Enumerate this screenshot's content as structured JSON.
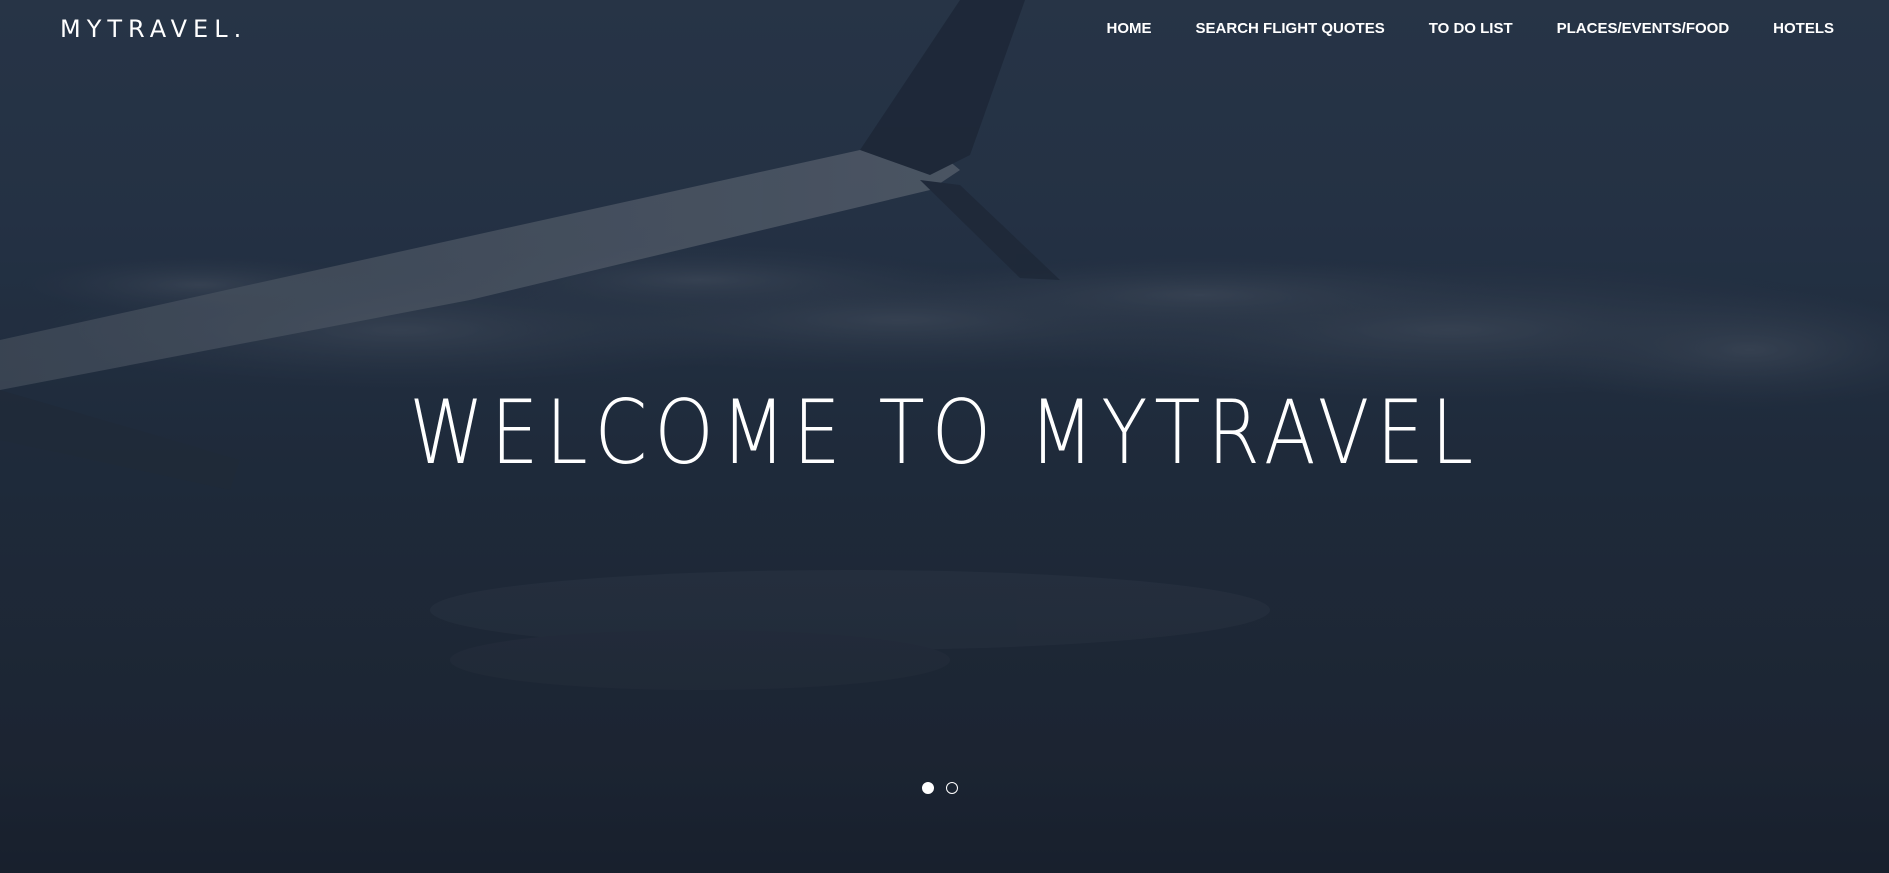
{
  "brand": {
    "name": "MYTRAVEL."
  },
  "nav": {
    "items": [
      {
        "label": "HOME"
      },
      {
        "label": "SEARCH FLIGHT QUOTES"
      },
      {
        "label": "TO DO LIST"
      },
      {
        "label": "PLACES/EVENTS/FOOD"
      },
      {
        "label": "HOTELS"
      }
    ]
  },
  "hero": {
    "headline": "WELCOME TO MYTRAVEL",
    "background": "airplane-wing-over-clouds-image",
    "slides": {
      "count": 2,
      "active": 1
    }
  },
  "colors": {
    "overlay": "#1f2a38",
    "text": "#ffffff"
  }
}
